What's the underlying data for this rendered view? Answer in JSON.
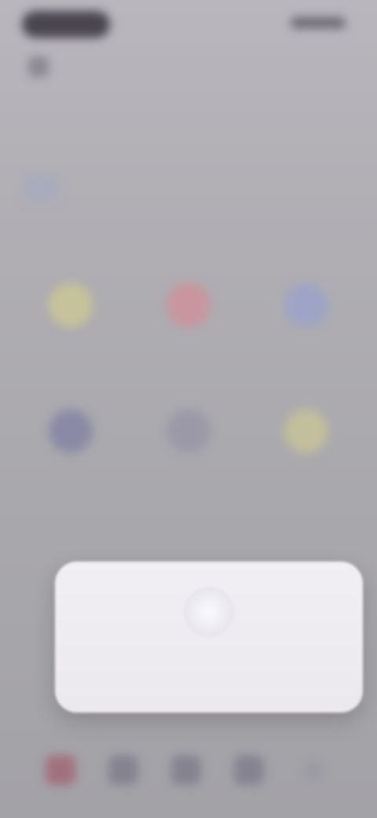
{
  "header": {
    "link_text": "",
    "title": "",
    "row_text": "",
    "row_trailing": "",
    "section_label": ""
  },
  "grid": {
    "tiles": [
      {
        "label": "",
        "icon": "star-icon",
        "color": "#c6c39a"
      },
      {
        "label": "",
        "icon": "heart-icon",
        "color": "#c9959e"
      },
      {
        "label": "",
        "icon": "globe-icon",
        "color": "#9ea4c6"
      },
      {
        "label": "",
        "icon": "shield-icon",
        "color": "#8a8aa6"
      },
      {
        "label": "",
        "icon": "settings-icon",
        "color": "#9b99a7"
      },
      {
        "label": "",
        "icon": "bulb-icon",
        "color": "#c2bf9c"
      }
    ]
  },
  "bottom": {
    "section_label": ""
  },
  "tabbar": {
    "tabs": [
      {
        "icon": "home-icon",
        "active": true
      },
      {
        "icon": "search-icon",
        "active": false
      },
      {
        "icon": "bell-icon",
        "active": false
      },
      {
        "icon": "profile-icon",
        "active": false
      },
      {
        "icon": "more-icon",
        "active": false
      }
    ]
  },
  "toast": {
    "icon": "info-icon",
    "message": "",
    "detail": ""
  },
  "colors": {
    "background": "#aeadb0",
    "toast_bg": "#efedf1",
    "active_tab": "#a1707d"
  }
}
